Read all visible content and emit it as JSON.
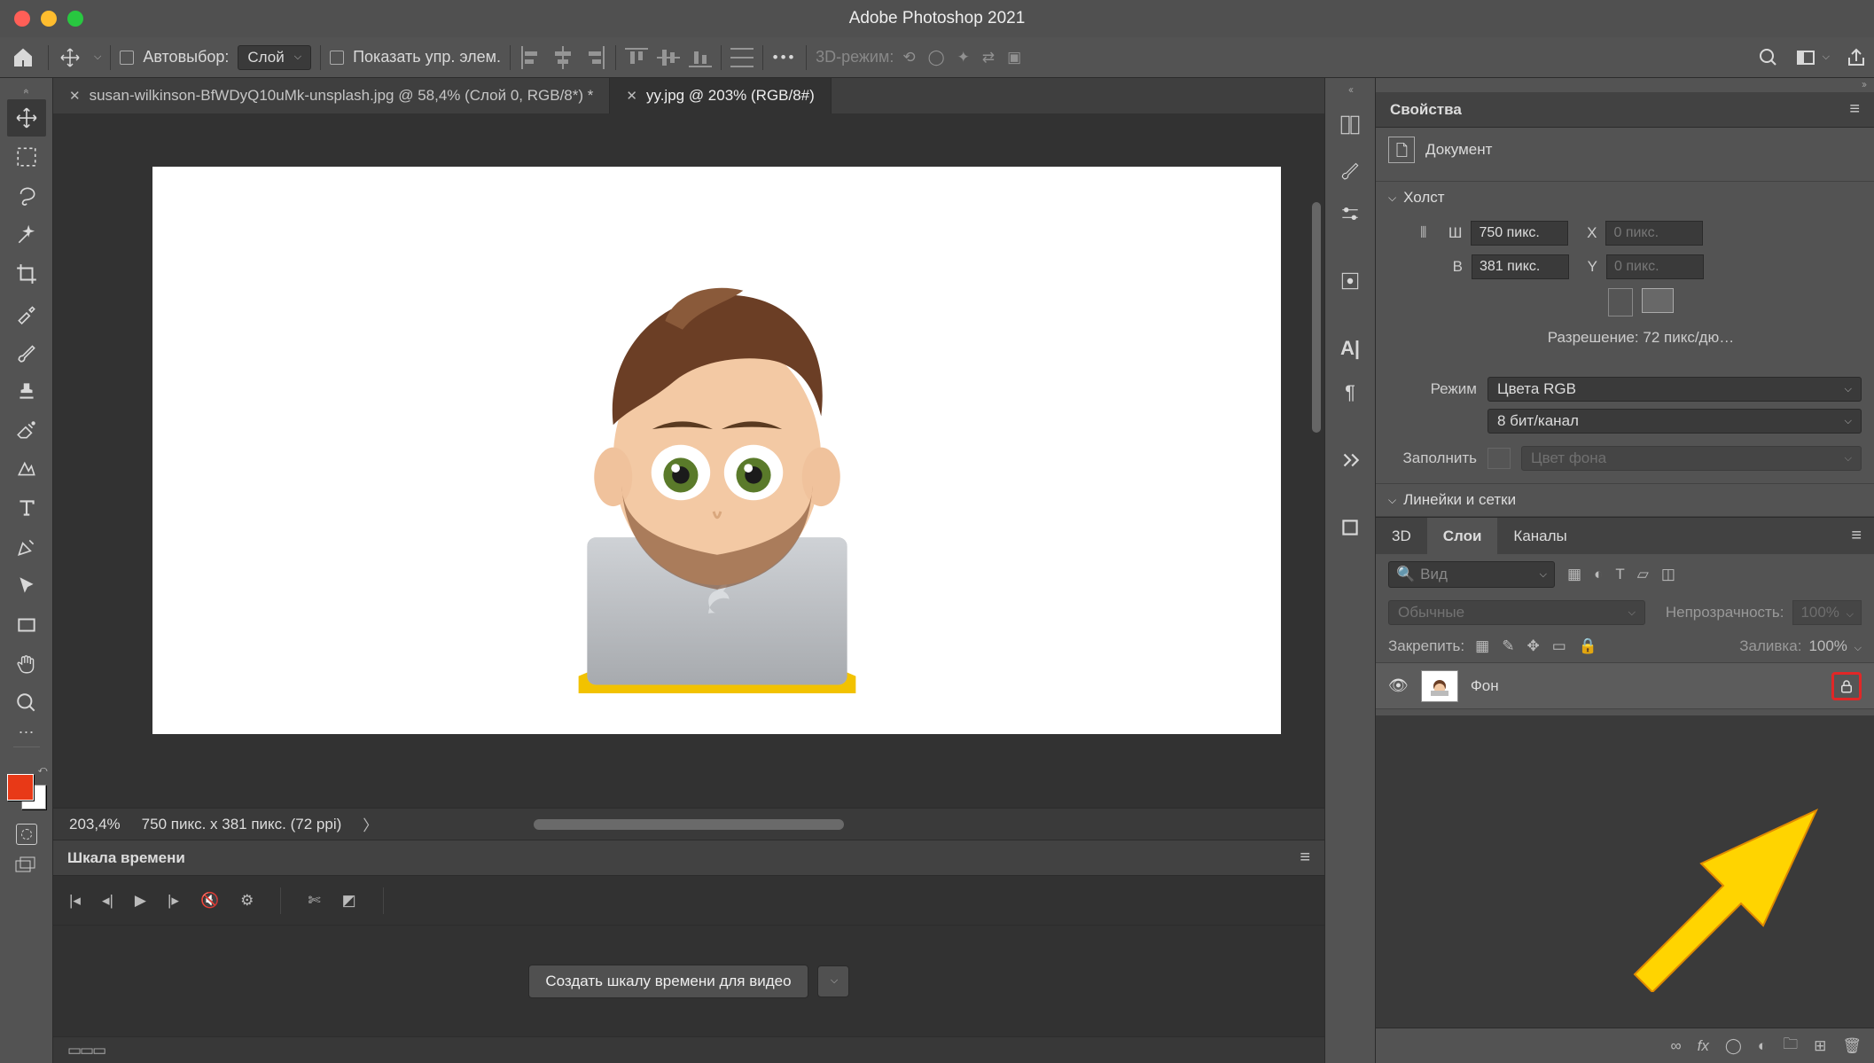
{
  "app": {
    "title": "Adobe Photoshop 2021"
  },
  "options": {
    "auto_select_label": "Автовыбор:",
    "auto_select_value": "Слой",
    "show_transform_label": "Показать упр. элем.",
    "mode3d_label": "3D-режим:"
  },
  "documents": {
    "tab1": "susan-wilkinson-BfWDyQ10uMk-unsplash.jpg @ 58,4% (Слой 0, RGB/8*) *",
    "tab2": "yy.jpg @ 203% (RGB/8#)"
  },
  "status": {
    "zoom": "203,4%",
    "info": "750 пикс. x 381 пикс. (72 ppi)"
  },
  "timeline": {
    "title": "Шкала времени",
    "create_btn": "Создать шкалу времени для видео"
  },
  "properties": {
    "title": "Свойства",
    "doc_label": "Документ",
    "canvas_section": "Холст",
    "w_label": "Ш",
    "w_value": "750 пикс.",
    "h_label": "В",
    "h_value": "381 пикс.",
    "x_label": "X",
    "x_value": "0 пикс.",
    "y_label": "Y",
    "y_value": "0 пикс.",
    "resolution": "Разрешение: 72 пикс/дю…",
    "mode_label": "Режим",
    "mode_value": "Цвета RGB",
    "bits_value": "8 бит/канал",
    "fill_label": "Заполнить",
    "fill_value": "Цвет фона",
    "rulers_section": "Линейки и сетки"
  },
  "layers": {
    "tab_3d": "3D",
    "tab_layers": "Слои",
    "tab_channels": "Каналы",
    "search_placeholder": "Вид",
    "blend_value": "Обычные",
    "opacity_label": "Непрозрачность:",
    "opacity_value": "100%",
    "lock_label": "Закрепить:",
    "fill_label": "Заливка:",
    "fill_value": "100%",
    "layer0": "Фон",
    "frame_indicator": "▭▭▭"
  }
}
